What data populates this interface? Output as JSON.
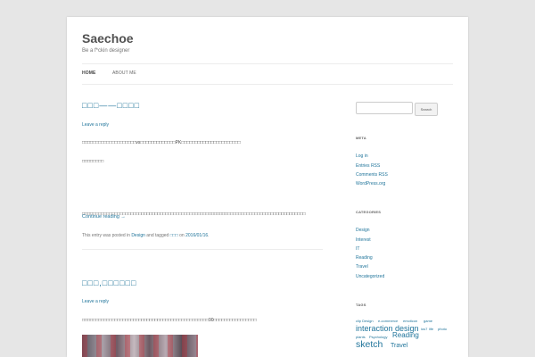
{
  "site": {
    "title": "Saechoe",
    "description": "Be a f*ckin designer"
  },
  "nav": {
    "home": "HOME",
    "about": "ABOUT ME"
  },
  "posts": [
    {
      "title": "□□□——□□□□",
      "leave_reply": "Leave a reply",
      "line1": "□□□□□□□□□□□□□□□□□□□□vs□□□□□□□□□□□□□PK□□□□□□□□□□□□□□□□□□□□□□",
      "line2": "□□□□□□□□",
      "line3": "□□□□□□□□□□□□□□□□□□□□□□□□□□□□□□□□□□□□□□□□□□□□□□□□□□□□□□□□□□□□□□□□□□□□□□□□□□□□□□□□□□□",
      "continue": "Continue reading →",
      "meta_prefix": "This entry was posted in ",
      "category": "Design",
      "meta_mid": " and tagged ",
      "tag": "□□□",
      "meta_on": " on ",
      "date": "2016/01/16",
      "meta_end": "."
    },
    {
      "title": "□□□,□□□□□□",
      "leave_reply": "Leave a reply",
      "line1": "□□□□□□□□□□□□□□□□□□□□□□□□□□□□□□□□□□□□□□□□□□□□□□□90□□□□□□□□□□□□□□□□"
    }
  ],
  "sidebar": {
    "search_button": "Search",
    "meta_title": "META",
    "meta_links": [
      "Log in",
      "Entries RSS",
      "Comments RSS",
      "WordPress.org"
    ],
    "categories_title": "CATEGORIES",
    "categories": [
      "Design",
      "Interest",
      "IT",
      "Reading",
      "Travel",
      "Uncategorized"
    ],
    "tags_title": "TAGS",
    "tags": [
      "clip Design",
      "e-commerce",
      "emoticon",
      "game",
      "interaction design",
      "ios7",
      "life",
      "photo",
      "plants",
      "Psychology",
      "Reading",
      "sketch",
      "Travel"
    ]
  }
}
